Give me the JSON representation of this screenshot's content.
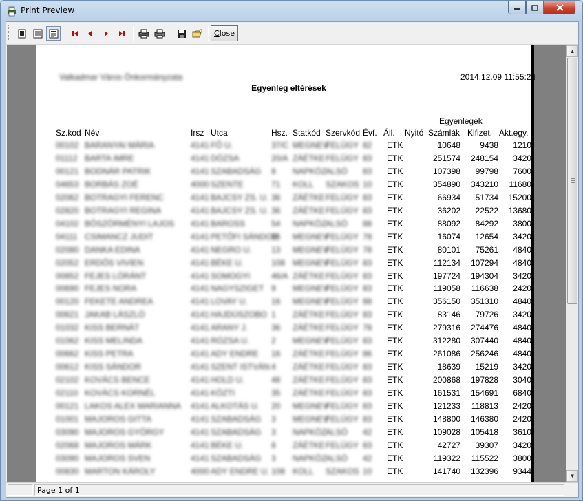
{
  "window": {
    "title": "Print Preview",
    "icon": "printer-app-icon"
  },
  "toolbar": {
    "buttons": [
      {
        "name": "one-page-icon",
        "tip": ""
      },
      {
        "name": "page-width-icon",
        "tip": ""
      },
      {
        "name": "multi-page-icon",
        "tip": ""
      },
      {
        "name": "first-page-icon",
        "tip": ""
      },
      {
        "name": "prev-page-icon",
        "tip": ""
      },
      {
        "name": "next-page-icon",
        "tip": ""
      },
      {
        "name": "last-page-icon",
        "tip": ""
      },
      {
        "name": "print-setup-icon",
        "tip": ""
      },
      {
        "name": "print-icon",
        "tip": ""
      },
      {
        "name": "save-icon",
        "tip": ""
      },
      {
        "name": "open-icon",
        "tip": ""
      }
    ],
    "close_label_first": "C",
    "close_label_rest": "lose"
  },
  "report": {
    "org_name": "Valkadmar Város Önkormányzata",
    "timestamp": "2014.12.09 11:55:24",
    "title": "Egyenleg eltérések",
    "group_header": "Egyenlegek",
    "columns": [
      "Sz.kod",
      "Név",
      "Irsz",
      "Utca",
      "Hsz.",
      "Statkód",
      "Szervkód",
      "Évf.",
      "Áll.",
      "Nyitó",
      "Számlák",
      "Kifizet.",
      "Akt.egy."
    ],
    "rows": [
      {
        "code": "00102",
        "name": "BARANYAI MÁRIA",
        "irsz": "4141",
        "street": "FŐ U.",
        "hsz": "37/C",
        "stat": "MEGNEV",
        "szerv": "FELÜGY",
        "evf": "82",
        "all": "ETK",
        "szamlak": "10648",
        "kifizet": "9438",
        "akt": "1210"
      },
      {
        "code": "01112",
        "name": "BARTA IMRE",
        "irsz": "4141",
        "street": "DÓZSA",
        "hsz": "20/A",
        "stat": "ZÁÉTKE",
        "szerv": "FELÜGY",
        "evf": "83",
        "all": "ETK",
        "szamlak": "251574",
        "kifizet": "248154",
        "akt": "3420"
      },
      {
        "code": "00121",
        "name": "BODNÁR PATRIK",
        "irsz": "4141",
        "street": "SZABADSÁG",
        "hsz": "8",
        "stat": "NAPKÖZ",
        "szerv": "ALSÓ",
        "evf": "83",
        "all": "ETK",
        "szamlak": "107398",
        "kifizet": "99798",
        "akt": "7600"
      },
      {
        "code": "04653",
        "name": "BORBÁS ZOÉ",
        "irsz": "4000",
        "street": "SZENTE",
        "hsz": "71",
        "stat": "KOLL",
        "szerv": "SZAKOS",
        "evf": "10",
        "all": "ETK",
        "szamlak": "354890",
        "kifizet": "343210",
        "akt": "11680"
      },
      {
        "code": "02062",
        "name": "BOTRAGYI FERENC",
        "irsz": "4141",
        "street": "BAJCSY ZS. U.",
        "hsz": "36",
        "stat": "ZÁÉTKE",
        "szerv": "FELÜGY",
        "evf": "83",
        "all": "ETK",
        "szamlak": "66934",
        "kifizet": "51734",
        "akt": "15200"
      },
      {
        "code": "02820",
        "name": "BOTRAGYI REGINA",
        "irsz": "4141",
        "street": "BAJCSY ZS. U.",
        "hsz": "36",
        "stat": "ZÁÉTKE",
        "szerv": "FELÜGY",
        "evf": "83",
        "all": "ETK",
        "szamlak": "36202",
        "kifizet": "22522",
        "akt": "13680"
      },
      {
        "code": "04102",
        "name": "BÖSZÖRMÉNYI LAJOS",
        "irsz": "4141",
        "street": "BAROSS",
        "hsz": "54",
        "stat": "NAPKÖZ",
        "szerv": "ALSÓ",
        "evf": "88",
        "all": "ETK",
        "szamlak": "88092",
        "kifizet": "84292",
        "akt": "3800"
      },
      {
        "code": "04111",
        "name": "CSIMANCZ JUDIT",
        "irsz": "4141",
        "street": "PETŐFI SÁNDOR",
        "hsz": "16",
        "stat": "MEGNEV",
        "szerv": "FELÜGY",
        "evf": "78",
        "all": "ETK",
        "szamlak": "16074",
        "kifizet": "12654",
        "akt": "3420"
      },
      {
        "code": "02080",
        "name": "DANKA EDINA",
        "irsz": "4141",
        "street": "NEGRO U.",
        "hsz": "13",
        "stat": "MEGNEV",
        "szerv": "FELÜGY",
        "evf": "78",
        "all": "ETK",
        "szamlak": "80101",
        "kifizet": "75261",
        "akt": "4840"
      },
      {
        "code": "02052",
        "name": "ERDŐS VIVIEN",
        "irsz": "4141",
        "street": "BÉKE U.",
        "hsz": "108",
        "stat": "MEGNEV",
        "szerv": "FELÜGY",
        "evf": "83",
        "all": "ETK",
        "szamlak": "112134",
        "kifizet": "107294",
        "akt": "4840"
      },
      {
        "code": "00852",
        "name": "FEJES LÓRÁNT",
        "irsz": "4141",
        "street": "SOMOGYI",
        "hsz": "46/A",
        "stat": "ZÁÉTKE",
        "szerv": "FELÜGY",
        "evf": "83",
        "all": "ETK",
        "szamlak": "197724",
        "kifizet": "194304",
        "akt": "3420"
      },
      {
        "code": "00690",
        "name": "FEJES NORA",
        "irsz": "4141",
        "street": "NAGYSZIGET",
        "hsz": "9",
        "stat": "MEGNEV",
        "szerv": "FELÜGY",
        "evf": "83",
        "all": "ETK",
        "szamlak": "119058",
        "kifizet": "116638",
        "akt": "2420"
      },
      {
        "code": "00120",
        "name": "FEKETE ANDREA",
        "irsz": "4141",
        "street": "LOVAY U.",
        "hsz": "16",
        "stat": "MEGNEV",
        "szerv": "FELÜGY",
        "evf": "88",
        "all": "ETK",
        "szamlak": "356150",
        "kifizet": "351310",
        "akt": "4840"
      },
      {
        "code": "00621",
        "name": "JAKAB LÁSZLÓ",
        "irsz": "4141",
        "street": "HAJDÚSZOBO",
        "hsz": "1",
        "stat": "ZÁÉTKE",
        "szerv": "FELÜGY",
        "evf": "83",
        "all": "ETK",
        "szamlak": "83146",
        "kifizet": "79726",
        "akt": "3420"
      },
      {
        "code": "01032",
        "name": "KISS BERNÁT",
        "irsz": "4141",
        "street": "ARANY J.",
        "hsz": "36",
        "stat": "ZÁÉTKE",
        "szerv": "FELÜGY",
        "evf": "78",
        "all": "ETK",
        "szamlak": "279316",
        "kifizet": "274476",
        "akt": "4840"
      },
      {
        "code": "01062",
        "name": "KISS MELINDA",
        "irsz": "4141",
        "street": "RÓZSA U.",
        "hsz": "2",
        "stat": "MEGNEV",
        "szerv": "FELÜGY",
        "evf": "83",
        "all": "ETK",
        "szamlak": "312280",
        "kifizet": "307440",
        "akt": "4840"
      },
      {
        "code": "00662",
        "name": "KISS PETRA",
        "irsz": "4141",
        "street": "ADY ENDRE",
        "hsz": "16",
        "stat": "ZÁÉTKE",
        "szerv": "FELÜGY",
        "evf": "86",
        "all": "ETK",
        "szamlak": "261086",
        "kifizet": "256246",
        "akt": "4840"
      },
      {
        "code": "00612",
        "name": "KISS SÁNDOR",
        "irsz": "4141",
        "street": "SZENT ISTVÁN",
        "hsz": "4",
        "stat": "ZÁÉTKE",
        "szerv": "FELÜGY",
        "evf": "83",
        "all": "ETK",
        "szamlak": "18639",
        "kifizet": "15219",
        "akt": "3420"
      },
      {
        "code": "02102",
        "name": "KOVÁCS BENCE",
        "irsz": "4141",
        "street": "HOLD U.",
        "hsz": "48",
        "stat": "ZÁÉTKE",
        "szerv": "FELÜGY",
        "evf": "83",
        "all": "ETK",
        "szamlak": "200868",
        "kifizet": "197828",
        "akt": "3040"
      },
      {
        "code": "02110",
        "name": "KOVÁCS KORNÉL",
        "irsz": "4141",
        "street": "KÖZTI",
        "hsz": "35",
        "stat": "ZÁÉTKE",
        "szerv": "FELÜGY",
        "evf": "83",
        "all": "ETK",
        "szamlak": "161531",
        "kifizet": "154691",
        "akt": "6840"
      },
      {
        "code": "00121",
        "name": "LAKOS ALEX MARIANNA",
        "irsz": "4141",
        "street": "ALKOTÁS U.",
        "hsz": "20",
        "stat": "MEGNEV",
        "szerv": "FELÜGY",
        "evf": "83",
        "all": "ETK",
        "szamlak": "121233",
        "kifizet": "118813",
        "akt": "2420"
      },
      {
        "code": "01001",
        "name": "MAJOROS GITTA",
        "irsz": "4141",
        "street": "SZABADSÁG",
        "hsz": "3",
        "stat": "MEGNEV",
        "szerv": "FELÜGY",
        "evf": "83",
        "all": "ETK",
        "szamlak": "148800",
        "kifizet": "146380",
        "akt": "2420"
      },
      {
        "code": "03090",
        "name": "MAJOROS GYÖRGY",
        "irsz": "4141",
        "street": "SZABADSÁG",
        "hsz": "3",
        "stat": "NAPKÖZ",
        "szerv": "ALSÓ",
        "evf": "42",
        "all": "ETK",
        "szamlak": "109028",
        "kifizet": "105418",
        "akt": "3610"
      },
      {
        "code": "02068",
        "name": "MAJOROS MÁRK",
        "irsz": "4141",
        "street": "BÉKE U.",
        "hsz": "8",
        "stat": "ZÁÉTKE",
        "szerv": "FELÜGY",
        "evf": "83",
        "all": "ETK",
        "szamlak": "42727",
        "kifizet": "39307",
        "akt": "3420"
      },
      {
        "code": "03090",
        "name": "MAJOROS SVEN",
        "irsz": "4141",
        "street": "SZABADSÁG",
        "hsz": "3",
        "stat": "NAPKÖZ",
        "szerv": "ALSÓ",
        "evf": "42",
        "all": "ETK",
        "szamlak": "119322",
        "kifizet": "115522",
        "akt": "3800"
      },
      {
        "code": "00830",
        "name": "MARTON KÁROLY",
        "irsz": "4000",
        "street": "ADY ENDRE U.",
        "hsz": "108",
        "stat": "KOLL",
        "szerv": "SZAKOS",
        "evf": "10",
        "all": "ETK",
        "szamlak": "141740",
        "kifizet": "132396",
        "akt": "9344"
      }
    ]
  },
  "scrollbar": {
    "up": "▲",
    "down": "▼"
  },
  "status": {
    "page": "Page 1 of 1"
  }
}
